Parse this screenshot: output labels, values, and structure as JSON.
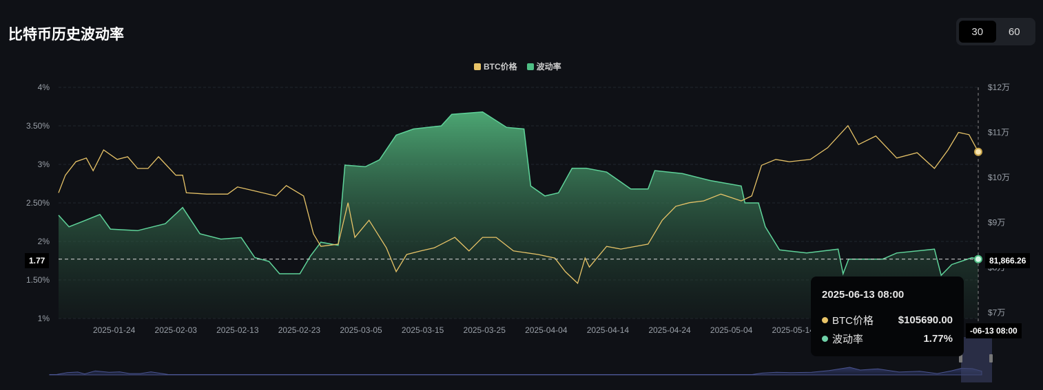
{
  "title": "比特币历史波动率",
  "period_toggle": {
    "options": [
      "30",
      "60"
    ],
    "selected": "30"
  },
  "colors": {
    "price": "#e8c468",
    "vol": "#4fbf85",
    "bg": "#0f1116"
  },
  "tooltip": {
    "date": "2025-06-13 08:00",
    "rows": [
      {
        "label": "BTC价格",
        "value": "$105690.00"
      },
      {
        "label": "波动率",
        "value": "1.77%"
      }
    ]
  },
  "crosshair": {
    "left_label": "1.77",
    "right_label": "81,866.26",
    "bottom_label": "-06-13 08:00"
  },
  "chart_data": {
    "type": "line",
    "legend": [
      "BTC价格",
      "波动率"
    ],
    "legend_position": "top-center",
    "x_start_date": "2025-01-15",
    "x_unit": "days since start",
    "xlim": [
      0,
      149
    ],
    "x_ticks": [
      "2025-01-24",
      "2025-02-03",
      "2025-02-13",
      "2025-02-23",
      "2025-03-05",
      "2025-03-15",
      "2025-03-25",
      "2025-04-04",
      "2025-04-14",
      "2025-04-24",
      "2025-05-04",
      "2025-05-14"
    ],
    "y_left": {
      "label": "波动率",
      "ylim": [
        1,
        4
      ],
      "ticks": [
        "1%",
        "1.50%",
        "2%",
        "2.50%",
        "3%",
        "3.50%",
        "4%"
      ]
    },
    "y_right": {
      "label": "BTC价格",
      "ylim": [
        70000,
        120000
      ],
      "ticks": [
        "$7万",
        "$8万",
        "$9万",
        "$10万",
        "$11万",
        "$12万"
      ]
    },
    "series": [
      {
        "name": "波动率",
        "unit": "%",
        "points": [
          [
            0,
            2.34
          ],
          [
            1.7,
            2.19
          ],
          [
            3.9,
            2.26
          ],
          [
            6.7,
            2.35
          ],
          [
            8.4,
            2.16
          ],
          [
            12.8,
            2.14
          ],
          [
            17.3,
            2.23
          ],
          [
            20.1,
            2.44
          ],
          [
            22.9,
            2.1
          ],
          [
            26.3,
            2.03
          ],
          [
            29.6,
            2.05
          ],
          [
            31.8,
            1.79
          ],
          [
            34.1,
            1.74
          ],
          [
            35.8,
            1.58
          ],
          [
            39.1,
            1.58
          ],
          [
            40.8,
            1.81
          ],
          [
            42.5,
            1.99
          ],
          [
            45.3,
            1.95
          ],
          [
            46.4,
            2.99
          ],
          [
            49.7,
            2.97
          ],
          [
            52,
            3.06
          ],
          [
            54.7,
            3.38
          ],
          [
            57.5,
            3.46
          ],
          [
            62,
            3.5
          ],
          [
            63.7,
            3.65
          ],
          [
            68.7,
            3.68
          ],
          [
            72.6,
            3.48
          ],
          [
            75.4,
            3.46
          ],
          [
            76.5,
            2.72
          ],
          [
            78.8,
            2.59
          ],
          [
            81,
            2.63
          ],
          [
            83.2,
            2.95
          ],
          [
            85.5,
            2.95
          ],
          [
            88.8,
            2.9
          ],
          [
            92.7,
            2.68
          ],
          [
            95.5,
            2.68
          ],
          [
            96.6,
            2.92
          ],
          [
            101.1,
            2.88
          ],
          [
            105.6,
            2.79
          ],
          [
            110.6,
            2.72
          ],
          [
            111.2,
            2.5
          ],
          [
            113.4,
            2.5
          ],
          [
            114.5,
            2.19
          ],
          [
            116.8,
            1.89
          ],
          [
            121.2,
            1.85
          ],
          [
            126.3,
            1.9
          ],
          [
            127.1,
            1.58
          ],
          [
            128,
            1.77
          ],
          [
            133.5,
            1.77
          ],
          [
            135.8,
            1.85
          ],
          [
            141.9,
            1.9
          ],
          [
            143,
            1.56
          ],
          [
            144.7,
            1.7
          ],
          [
            148.0,
            1.79
          ],
          [
            149,
            1.77
          ]
        ]
      },
      {
        "name": "BTC价格",
        "unit": "USD",
        "points": [
          [
            0,
            96600
          ],
          [
            1.1,
            100500
          ],
          [
            2.8,
            103500
          ],
          [
            4.5,
            104300
          ],
          [
            5.6,
            101500
          ],
          [
            7.3,
            106100
          ],
          [
            9.5,
            104000
          ],
          [
            11.2,
            104600
          ],
          [
            12.8,
            102000
          ],
          [
            14.5,
            102000
          ],
          [
            16.2,
            104600
          ],
          [
            19,
            100500
          ],
          [
            20.1,
            100500
          ],
          [
            20.7,
            96600
          ],
          [
            24,
            96300
          ],
          [
            27.4,
            96300
          ],
          [
            29,
            97900
          ],
          [
            31.8,
            97000
          ],
          [
            35.2,
            95900
          ],
          [
            36.9,
            98200
          ],
          [
            39.7,
            95900
          ],
          [
            41.3,
            87500
          ],
          [
            42.5,
            84700
          ],
          [
            45.3,
            85200
          ],
          [
            46.9,
            94400
          ],
          [
            48,
            86700
          ],
          [
            50.3,
            90500
          ],
          [
            53.1,
            84400
          ],
          [
            54.7,
            79100
          ],
          [
            56.4,
            82900
          ],
          [
            58.7,
            83700
          ],
          [
            60.9,
            84400
          ],
          [
            64.2,
            86700
          ],
          [
            66.5,
            83700
          ],
          [
            68.7,
            86700
          ],
          [
            70.9,
            86700
          ],
          [
            73.7,
            83700
          ],
          [
            77.7,
            82900
          ],
          [
            80.4,
            82100
          ],
          [
            82.1,
            79100
          ],
          [
            84.1,
            76500
          ],
          [
            85.3,
            82100
          ],
          [
            86,
            80100
          ],
          [
            88.8,
            84700
          ],
          [
            91.1,
            84100
          ],
          [
            95.5,
            85200
          ],
          [
            97.8,
            90500
          ],
          [
            100,
            93600
          ],
          [
            102.2,
            94400
          ],
          [
            104.5,
            94800
          ],
          [
            107.3,
            96300
          ],
          [
            110.6,
            94800
          ],
          [
            112.3,
            95900
          ],
          [
            113.9,
            102700
          ],
          [
            116.2,
            104000
          ],
          [
            118.4,
            103500
          ],
          [
            121.8,
            104000
          ],
          [
            124.6,
            106600
          ],
          [
            127.9,
            111500
          ],
          [
            129.6,
            107300
          ],
          [
            132.4,
            109200
          ],
          [
            135.8,
            104300
          ],
          [
            139.1,
            105500
          ],
          [
            141.9,
            102000
          ],
          [
            144.1,
            106100
          ],
          [
            145.8,
            110000
          ],
          [
            147.5,
            109500
          ],
          [
            149,
            105690
          ]
        ]
      }
    ]
  }
}
